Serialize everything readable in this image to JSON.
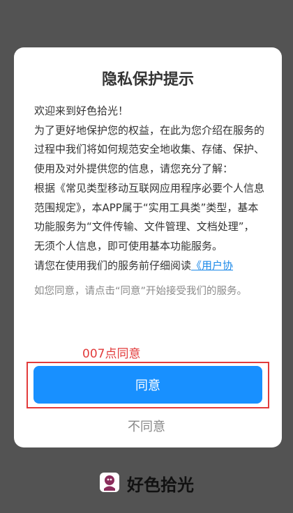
{
  "dialog": {
    "title": "隐私保护提示",
    "paragraphs": [
      "欢迎来到好色拾光！",
      "为了更好地保护您的权益，在此为您介绍在服务的过程中我们将如何规范安全地收集、存储、保护、使用及对外提供您的信息，请您充分了解：",
      "根据《常见类型移动互联网应用程序必要个人信息范围规定》，本APP属于“实用工具类”类型，基本功能服务为“文件传输、文件管理、文档处理”，无须个人信息，即可使用基本功能服务。"
    ],
    "read_prefix": "请您在使用我们的服务前仔细阅读",
    "read_link": "《用户协",
    "footnote": "如您同意，请点击“同意”开始接受我们的服务。",
    "annotation": "007点同意",
    "agree_label": "同意",
    "disagree_label": "不同意"
  },
  "brand": {
    "name": "好色拾光",
    "logo_icon": "app-logo-icon"
  },
  "colors": {
    "overlay": "#535353",
    "accent": "#1890ff",
    "annotation": "#e23b3b"
  }
}
